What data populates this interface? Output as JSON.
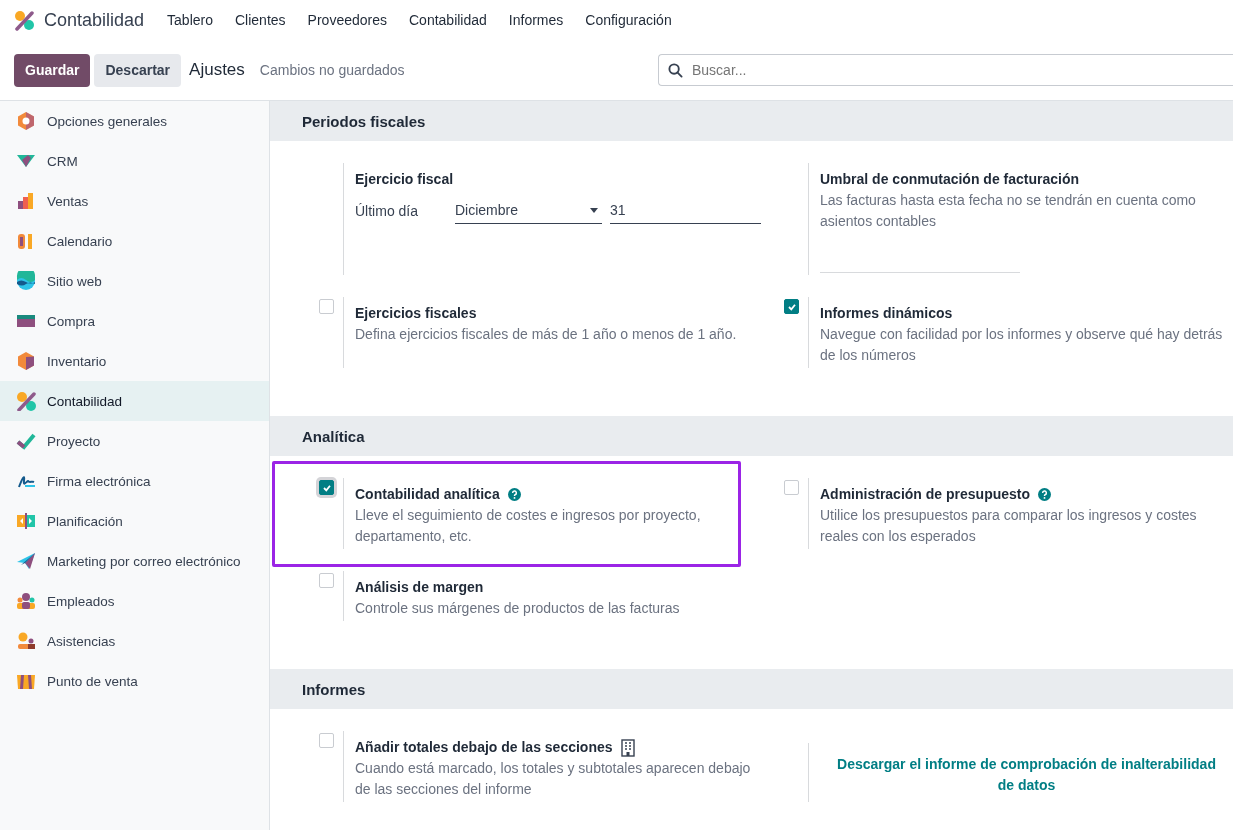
{
  "app": {
    "name": "Contabilidad"
  },
  "menu": [
    {
      "label": "Tablero"
    },
    {
      "label": "Clientes"
    },
    {
      "label": "Proveedores"
    },
    {
      "label": "Contabilidad"
    },
    {
      "label": "Informes"
    },
    {
      "label": "Configuración"
    }
  ],
  "control_panel": {
    "save": "Guardar",
    "discard": "Descartar",
    "breadcrumb": "Ajustes",
    "status": "Cambios no guardados",
    "search": {
      "placeholder": "Buscar..."
    }
  },
  "sidebar": {
    "items": [
      {
        "label": "Opciones generales",
        "selected": false
      },
      {
        "label": "CRM",
        "selected": false
      },
      {
        "label": "Ventas",
        "selected": false
      },
      {
        "label": "Calendario",
        "selected": false
      },
      {
        "label": "Sitio web",
        "selected": false
      },
      {
        "label": "Compra",
        "selected": false
      },
      {
        "label": "Inventario",
        "selected": false
      },
      {
        "label": "Contabilidad",
        "selected": true
      },
      {
        "label": "Proyecto",
        "selected": false
      },
      {
        "label": "Firma electrónica",
        "selected": false
      },
      {
        "label": "Planificación",
        "selected": false
      },
      {
        "label": "Marketing por correo electrónico",
        "selected": false
      },
      {
        "label": "Empleados",
        "selected": false
      },
      {
        "label": "Asistencias",
        "selected": false
      },
      {
        "label": "Punto de venta",
        "selected": false
      }
    ]
  },
  "sections": [
    {
      "title": "Periodos fiscales",
      "settings": [
        {
          "kind": "fiscal_year",
          "title": "Ejercicio fiscal",
          "label": "Último día",
          "month": "Diciembre",
          "day": "31"
        },
        {
          "kind": "date",
          "title": "Umbral de conmutación de facturación",
          "description": "Las facturas hasta esta fecha no se tendrán en cuenta como asientos contables"
        },
        {
          "kind": "checkbox",
          "title": "Ejercicios fiscales",
          "description": "Defina ejercicios fiscales de más de 1 año o menos de 1 año.",
          "checked": false,
          "help": false,
          "highlighted": false,
          "company_dependent": false
        },
        {
          "kind": "checkbox",
          "title": "Informes dinámicos",
          "description": "Navegue con facilidad por los informes y observe qué hay detrás de los números",
          "checked": true,
          "help": false,
          "highlighted": false,
          "company_dependent": false
        }
      ]
    },
    {
      "title": "Analítica",
      "settings": [
        {
          "kind": "checkbox",
          "title": "Contabilidad analítica",
          "description": "Lleve el seguimiento de costes e ingresos por proyecto, departamento, etc.",
          "checked": true,
          "help": true,
          "highlighted": true,
          "company_dependent": false
        },
        {
          "kind": "checkbox",
          "title": "Administración de presupuesto",
          "description": "Utilice los presupuestos para comparar los ingresos y costes reales con los esperados",
          "checked": false,
          "help": true,
          "highlighted": false,
          "company_dependent": false
        },
        {
          "kind": "checkbox",
          "title": "Análisis de margen",
          "description": "Controle sus márgenes de productos de las facturas",
          "checked": false,
          "help": false,
          "highlighted": false,
          "company_dependent": false
        }
      ]
    },
    {
      "title": "Informes",
      "settings": [
        {
          "kind": "checkbox",
          "title": "Añadir totales debajo de las secciones",
          "description": "Cuando está marcado, los totales y subtotales aparecen debajo de las secciones del informe",
          "checked": false,
          "help": false,
          "highlighted": false,
          "company_dependent": true
        },
        {
          "kind": "link",
          "text": "Descargar el informe de comprobación de inalterabilidad de datos"
        }
      ]
    }
  ]
}
